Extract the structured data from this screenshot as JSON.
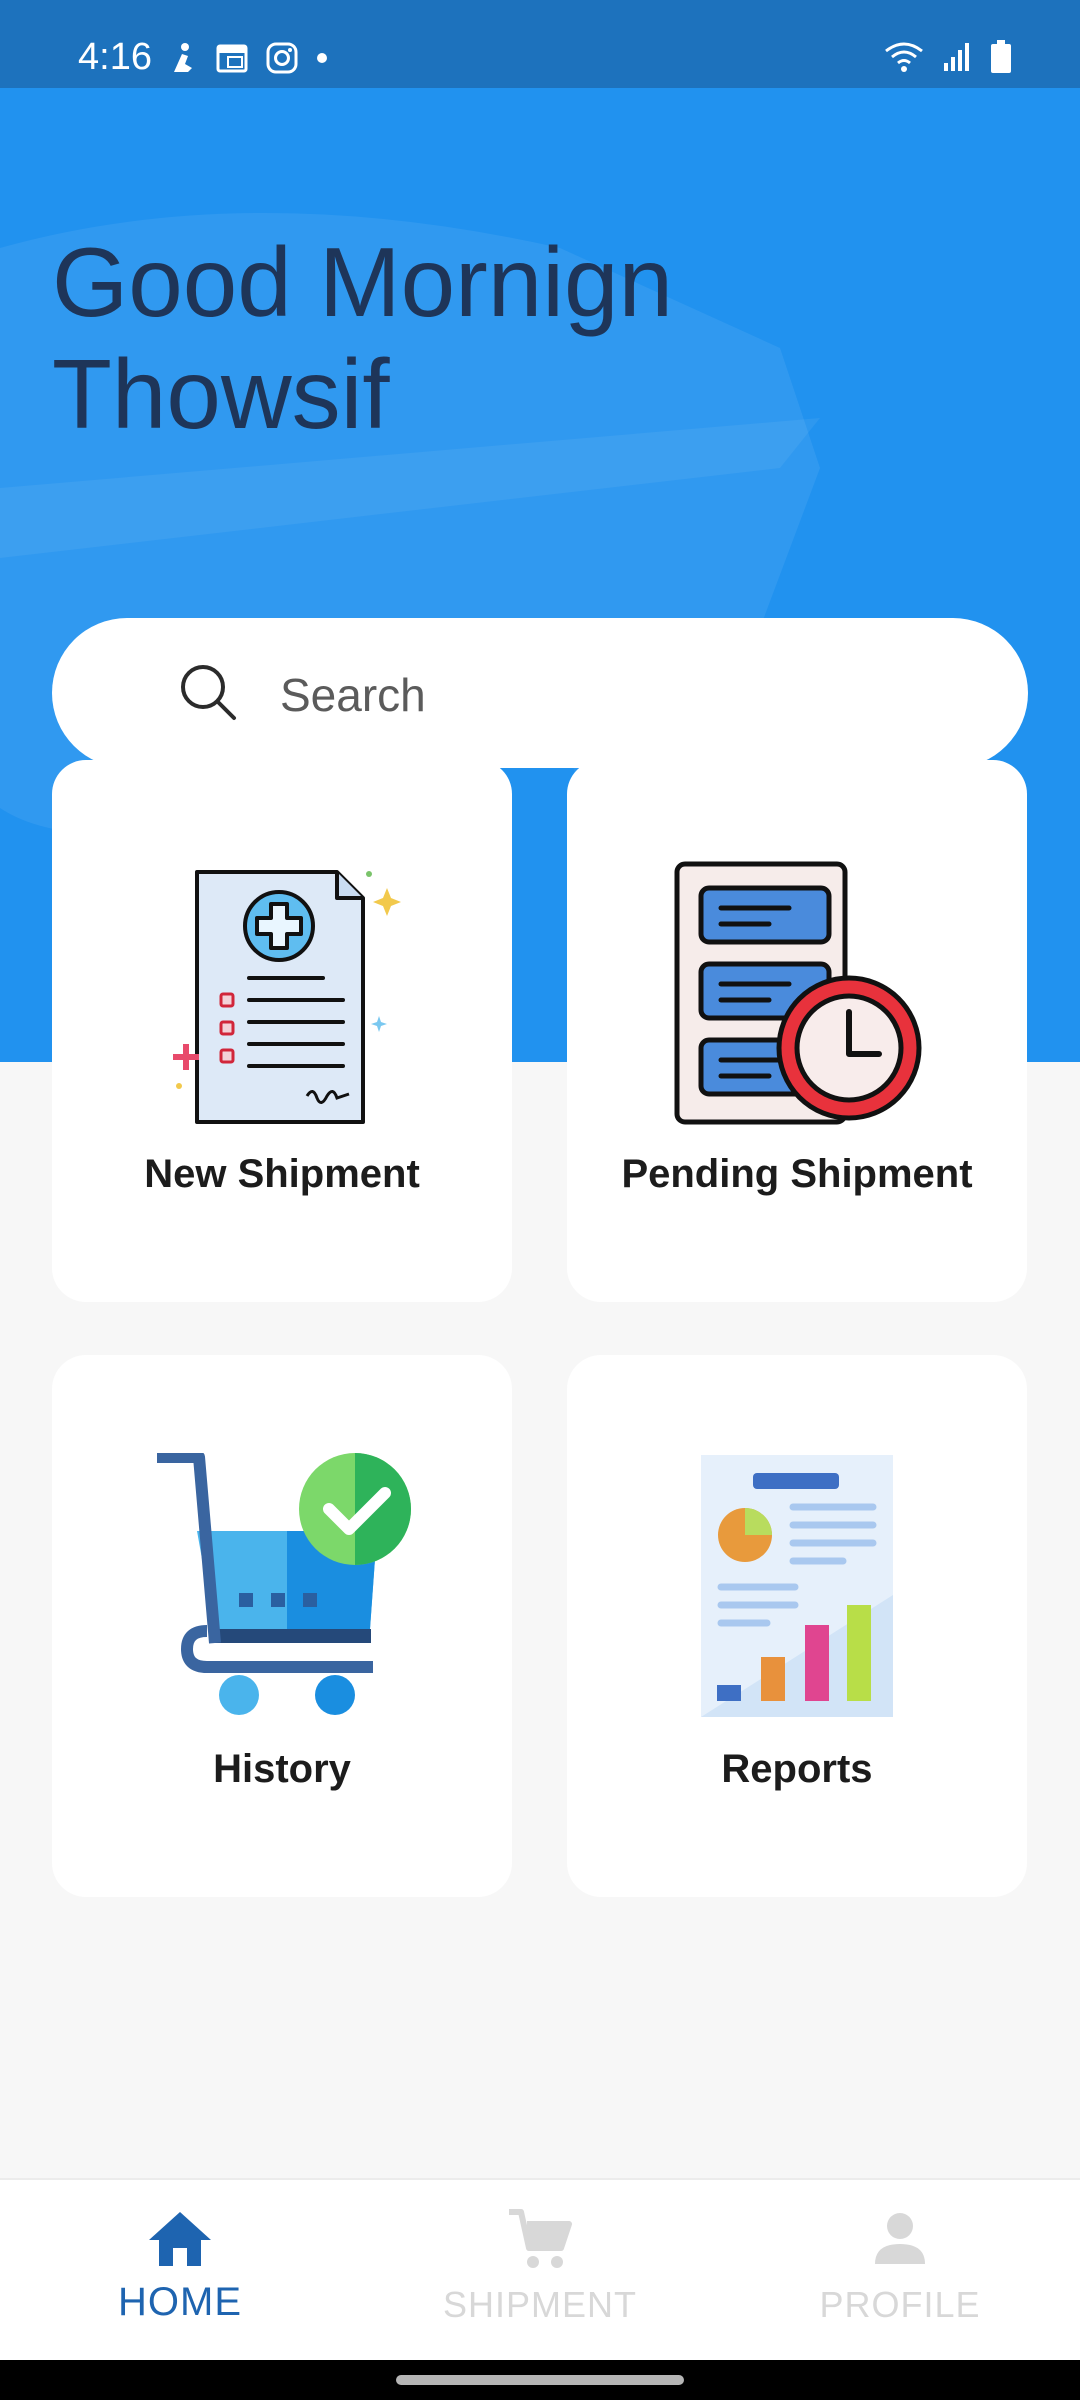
{
  "status_bar": {
    "time": "4:16",
    "left_icons": [
      "accessibility-icon",
      "calendar-icon",
      "instagram-icon",
      "dot-icon"
    ],
    "right_icons": [
      "wifi-icon",
      "signal-icon",
      "battery-icon"
    ]
  },
  "greeting": {
    "line1": "Good Mornign",
    "line2": "Thowsif"
  },
  "search": {
    "placeholder": "Search"
  },
  "cards": {
    "new_shipment": "New Shipment",
    "pending_shipment": "Pending Shipment",
    "history": "History",
    "reports": "Reports"
  },
  "bottom_nav": {
    "home": "HOME",
    "shipment": "SHIPMENT",
    "profile": "PROFILE",
    "active": "home"
  },
  "colors": {
    "status_bar": "#1d72bd",
    "hero": "#2192ef",
    "greeting_text": "#1e3559",
    "nav_active": "#1e64b0",
    "nav_inactive": "#d8d8d8"
  }
}
